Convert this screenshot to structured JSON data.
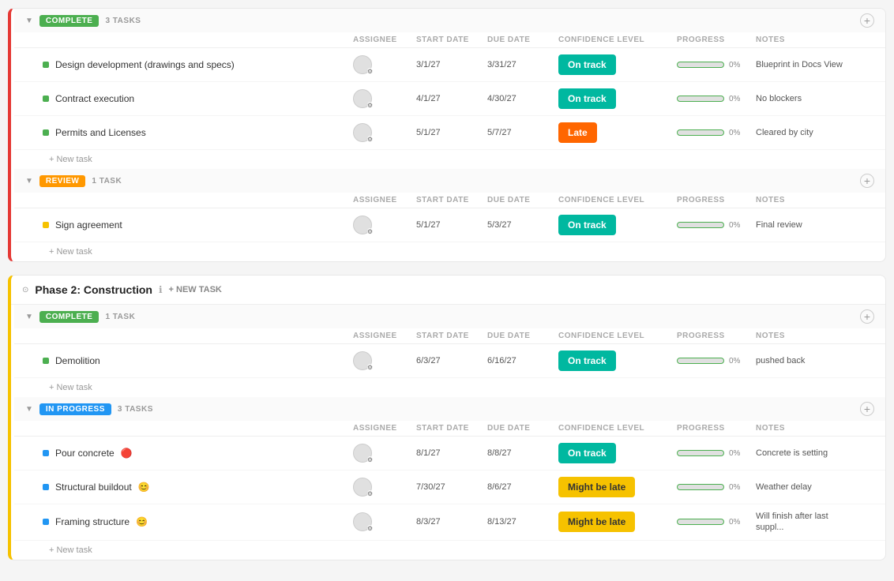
{
  "phases": [
    {
      "id": "phase1",
      "title": null,
      "leftBar": "red",
      "groups": [
        {
          "id": "complete1",
          "badge": "COMPLETE",
          "badgeClass": "badge-complete",
          "taskCount": "3 TASKS",
          "tasks": [
            {
              "name": "Design development (drawings and specs)",
              "dotClass": "dot-green",
              "assignee": "circle",
              "startDate": "3/1/27",
              "dueDate": "3/31/27",
              "confidence": "On track",
              "confClass": "conf-ontrack",
              "progress": 0,
              "notes": "Blueprint in Docs View",
              "statusEmoji": null
            },
            {
              "name": "Contract execution",
              "dotClass": "dot-green",
              "assignee": "circle",
              "startDate": "4/1/27",
              "dueDate": "4/30/27",
              "confidence": "On track",
              "confClass": "conf-ontrack",
              "progress": 0,
              "notes": "No blockers",
              "statusEmoji": null
            },
            {
              "name": "Permits and Licenses",
              "dotClass": "dot-green",
              "assignee": "circle",
              "startDate": "5/1/27",
              "dueDate": "5/7/27",
              "confidence": "Late",
              "confClass": "conf-late",
              "progress": 0,
              "notes": "Cleared by city",
              "statusEmoji": null
            }
          ],
          "newTaskLabel": "+ New task"
        },
        {
          "id": "review1",
          "badge": "REVIEW",
          "badgeClass": "badge-review",
          "taskCount": "1 TASK",
          "tasks": [
            {
              "name": "Sign agreement",
              "dotClass": "dot-yellow",
              "assignee": "circle",
              "startDate": "5/1/27",
              "dueDate": "5/3/27",
              "confidence": "On track",
              "confClass": "conf-ontrack",
              "progress": 0,
              "notes": "Final review",
              "statusEmoji": null
            }
          ],
          "newTaskLabel": "+ New task"
        }
      ]
    },
    {
      "id": "phase2",
      "title": "Phase 2: Construction",
      "leftBar": "yellow",
      "groups": [
        {
          "id": "complete2",
          "badge": "COMPLETE",
          "badgeClass": "badge-complete",
          "taskCount": "1 TASK",
          "tasks": [
            {
              "name": "Demolition",
              "dotClass": "dot-green",
              "assignee": "circle",
              "startDate": "6/3/27",
              "dueDate": "6/16/27",
              "confidence": "On track",
              "confClass": "conf-ontrack",
              "progress": 0,
              "notes": "pushed back",
              "statusEmoji": null
            }
          ],
          "newTaskLabel": "+ New task"
        },
        {
          "id": "inprogress1",
          "badge": "IN PROGRESS",
          "badgeClass": "badge-inprogress",
          "taskCount": "3 TASKS",
          "tasks": [
            {
              "name": "Pour concrete",
              "dotClass": "dot-blue",
              "assignee": "circle",
              "startDate": "8/1/27",
              "dueDate": "8/8/27",
              "confidence": "On track",
              "confClass": "conf-ontrack",
              "progress": 0,
              "notes": "Concrete is setting",
              "statusEmoji": "🔴"
            },
            {
              "name": "Structural buildout",
              "dotClass": "dot-blue",
              "assignee": "circle",
              "startDate": "7/30/27",
              "dueDate": "8/6/27",
              "confidence": "Might be late",
              "confClass": "conf-mightbelate",
              "progress": 0,
              "notes": "Weather delay",
              "statusEmoji": "😊"
            },
            {
              "name": "Framing structure",
              "dotClass": "dot-blue",
              "assignee": "circle",
              "startDate": "8/3/27",
              "dueDate": "8/13/27",
              "confidence": "Might be late",
              "confClass": "conf-mightbelate",
              "progress": 0,
              "notes": "Will finish after last suppl...",
              "statusEmoji": "😊"
            }
          ],
          "newTaskLabel": "+ New task"
        }
      ]
    }
  ],
  "colHeaders": {
    "task": "",
    "assignee": "ASSIGNEE",
    "startDate": "START DATE",
    "dueDate": "DUE DATE",
    "confidence": "CONFIDENCE LEVEL",
    "progress": "PROGRESS",
    "notes": "NOTES"
  },
  "newTaskPhaseLabel": "+ NEW TASK",
  "progressPct": "0%"
}
